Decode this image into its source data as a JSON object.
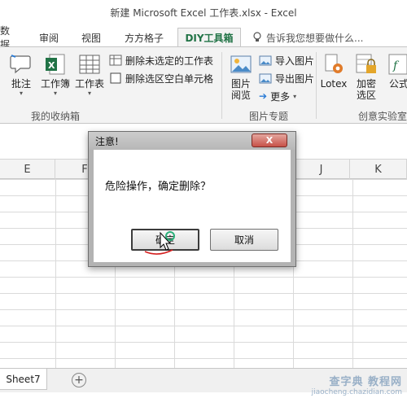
{
  "window": {
    "title": "新建 Microsoft Excel 工作表.xlsx - Excel"
  },
  "tabs": [
    {
      "label": "数据"
    },
    {
      "label": "审阅"
    },
    {
      "label": "视图"
    },
    {
      "label": "方方格子"
    },
    {
      "label": "DIY工具箱",
      "active": true
    }
  ],
  "tell_me": {
    "placeholder": "告诉我您想要做什么..."
  },
  "ribbon": {
    "group1": {
      "buttons": [
        {
          "label": "批注",
          "icon": "comment-icon"
        },
        {
          "label": "工作簿",
          "icon": "excel-workbook-icon"
        },
        {
          "label": "工作表",
          "icon": "worksheet-icon"
        }
      ],
      "small": [
        {
          "label": "删除未选定的工作表",
          "icon": "delete-sheets-icon"
        },
        {
          "label": "删除选区空白单元格",
          "icon": "delete-blank-cells-icon"
        }
      ],
      "label": "我的收纳箱"
    },
    "group2": {
      "button": {
        "label": "图片阅览",
        "icon": "picture-view-icon"
      },
      "small": [
        {
          "label": "导入图片",
          "icon": "import-picture-icon"
        },
        {
          "label": "导出图片",
          "icon": "export-picture-icon"
        },
        {
          "label": "更多",
          "icon": "arrow-right-icon"
        }
      ],
      "label": "图片专题"
    },
    "group3": {
      "buttons": [
        {
          "label": "Lotex",
          "icon": "gear-icon"
        },
        {
          "label": "加密选区",
          "icon": "lock-icon"
        },
        {
          "label": "公式",
          "icon": "formula-icon"
        }
      ],
      "label": "创意实验室"
    }
  },
  "grid": {
    "columns": [
      {
        "label": "E"
      },
      {
        "label": "F"
      },
      {
        "label": "J"
      },
      {
        "label": "K"
      }
    ]
  },
  "sheets": [
    {
      "label": "Sheet7"
    }
  ],
  "dialog": {
    "title": "注意!",
    "close_label": "X",
    "message": "危险操作，确定删除？",
    "ok_label": "确定",
    "cancel_label": "取消"
  },
  "watermark": {
    "line1": "查字典 教程网",
    "line2": "jiaocheng.chazidian.com"
  },
  "colors": {
    "accent": "#217346",
    "ribbon_bg": "#f3f3f3",
    "close_red": "#c75148"
  }
}
